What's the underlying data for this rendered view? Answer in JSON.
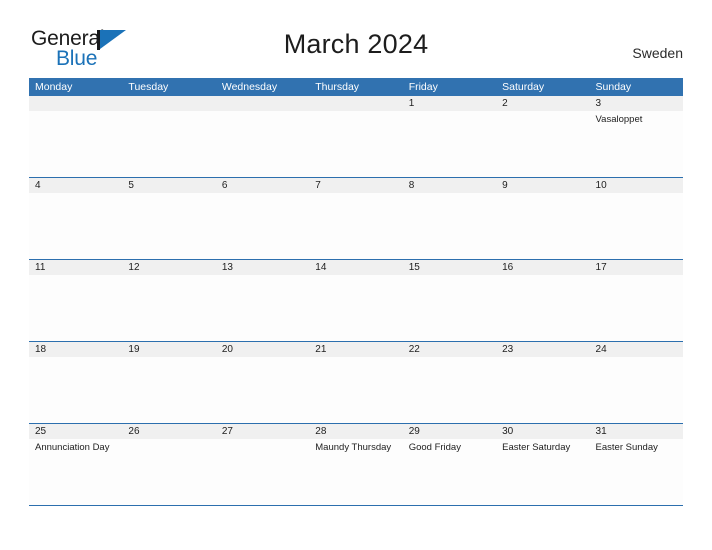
{
  "brand": {
    "name_part1": "General",
    "name_part2": "Blue",
    "flag_icon": "flag-icon",
    "accent_color": "#1b72b8"
  },
  "header": {
    "title": "March 2024",
    "country": "Sweden"
  },
  "calendar": {
    "header_bg": "#3172b0",
    "row_divider": "#2c6fae",
    "day_band_bg": "#f0f0f0",
    "weekdays": [
      "Monday",
      "Tuesday",
      "Wednesday",
      "Thursday",
      "Friday",
      "Saturday",
      "Sunday"
    ],
    "weeks": [
      [
        {
          "date": "",
          "events": []
        },
        {
          "date": "",
          "events": []
        },
        {
          "date": "",
          "events": []
        },
        {
          "date": "",
          "events": []
        },
        {
          "date": "1",
          "events": []
        },
        {
          "date": "2",
          "events": []
        },
        {
          "date": "3",
          "events": [
            "Vasaloppet"
          ]
        }
      ],
      [
        {
          "date": "4",
          "events": []
        },
        {
          "date": "5",
          "events": []
        },
        {
          "date": "6",
          "events": []
        },
        {
          "date": "7",
          "events": []
        },
        {
          "date": "8",
          "events": []
        },
        {
          "date": "9",
          "events": []
        },
        {
          "date": "10",
          "events": []
        }
      ],
      [
        {
          "date": "11",
          "events": []
        },
        {
          "date": "12",
          "events": []
        },
        {
          "date": "13",
          "events": []
        },
        {
          "date": "14",
          "events": []
        },
        {
          "date": "15",
          "events": []
        },
        {
          "date": "16",
          "events": []
        },
        {
          "date": "17",
          "events": []
        }
      ],
      [
        {
          "date": "18",
          "events": []
        },
        {
          "date": "19",
          "events": []
        },
        {
          "date": "20",
          "events": []
        },
        {
          "date": "21",
          "events": []
        },
        {
          "date": "22",
          "events": []
        },
        {
          "date": "23",
          "events": []
        },
        {
          "date": "24",
          "events": []
        }
      ],
      [
        {
          "date": "25",
          "events": [
            "Annunciation Day"
          ]
        },
        {
          "date": "26",
          "events": []
        },
        {
          "date": "27",
          "events": []
        },
        {
          "date": "28",
          "events": [
            "Maundy Thursday"
          ]
        },
        {
          "date": "29",
          "events": [
            "Good Friday"
          ]
        },
        {
          "date": "30",
          "events": [
            "Easter Saturday"
          ]
        },
        {
          "date": "31",
          "events": [
            "Easter Sunday"
          ]
        }
      ]
    ]
  }
}
